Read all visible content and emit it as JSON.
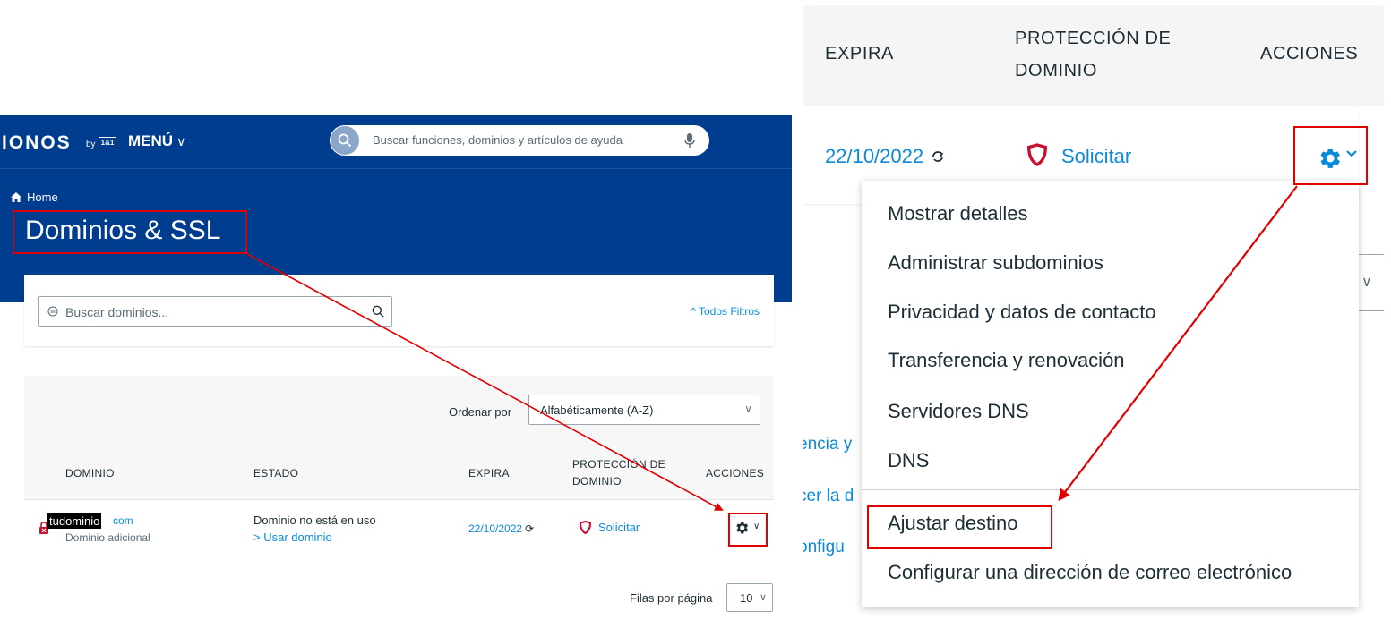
{
  "left": {
    "logo": "IONOS",
    "logo_by": "by",
    "logo_box": "1&1",
    "menu_label": "MENÚ",
    "search_placeholder": "Buscar funciones, dominios y artículos de ayuda",
    "breadcrumb_home": "Home",
    "page_title": "Dominios & SSL",
    "domain_search_placeholder": "Buscar dominios...",
    "all_filters": "^ Todos Filtros",
    "sort_label": "Ordenar por",
    "sort_value": "Alfabéticamente (A-Z)",
    "table": {
      "headers": {
        "domain": "DOMINIO",
        "status": "ESTADO",
        "expires": "EXPIRA",
        "protection_line1": "PROTECCIÓN DE",
        "protection_line2": "DOMINIO",
        "actions": "ACCIONES"
      },
      "row": {
        "domain_name": "tudominio",
        "domain_tld": "com",
        "domain_type": "Dominio adicional",
        "status": "Dominio no está en uso",
        "use_domain": "> Usar dominio",
        "expires": "22/10/2022",
        "protection": "Solicitar"
      }
    },
    "rows_per_page_label": "Filas por página",
    "rows_per_page_value": "10"
  },
  "right": {
    "headers": {
      "expires": "EXPIRA",
      "protection_line1": "PROTECCIÓN DE",
      "protection_line2": "DOMINIO",
      "actions": "ACCIONES"
    },
    "expires": "22/10/2022",
    "protection": "Solicitar",
    "background_links": [
      "encia y",
      "cer la d",
      "onfigu"
    ],
    "dropdown": {
      "items": [
        "Mostrar detalles",
        "Administrar subdominios",
        "Privacidad y datos de contacto",
        "Transferencia y renovación",
        "Servidores DNS",
        "DNS",
        "Ajustar destino",
        "Configurar una dirección de correo electrónico"
      ]
    }
  },
  "colors": {
    "brand_blue": "#003d8f",
    "link_blue": "#0b8ad9",
    "highlight_red": "#e10000",
    "shield_red": "#c8102e"
  },
  "icons": {
    "search": "search-icon",
    "mic": "microphone-icon",
    "home": "home-icon",
    "gear": "gear-icon",
    "shield": "shield-icon",
    "renew": "renew-icon",
    "lock": "lock-icon"
  }
}
